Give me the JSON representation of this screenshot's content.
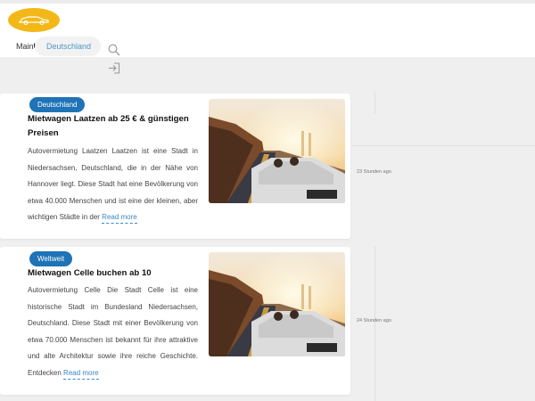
{
  "header": {
    "logo": {
      "name": "car-logo",
      "color": "#f3b818"
    },
    "nav": {
      "main_label": "Main",
      "pill_label": "Deutschland"
    },
    "icons": [
      "search-icon",
      "login-icon"
    ]
  },
  "articles": [
    {
      "badge": "Deutschland",
      "title": "Mietwagen Laatzen ab 25 € & günstigen Preisen",
      "excerpt": "Autovermietung Laatzen Laatzen ist eine Stadt in Niedersachsen, Deutschland, die in der Nähe von Hannover liegt. Diese Stadt hat eine Bevölkerung von etwa 40.000 Menschen und ist eine der kleinen, aber wichtigen Städte in der",
      "read_more": "Read more",
      "timestamp": "23 Stunden ago",
      "image_alt": "convertible-car-sunset-photo"
    },
    {
      "badge": "Weltweit",
      "title": "Mietwagen Celle buchen ab 10",
      "excerpt": "Autovermietung Celle Die Stadt Celle ist eine historische Stadt im Bundesland Niedersachsen, Deutschland. Diese Stadt mit einer Bevölkerung von etwa 70.000 Menschen ist bekannt für ihre attraktive und alte Architektur sowie ihre reiche Geschichte. Entdecken",
      "read_more": "Read more",
      "timestamp": "24 Stunden ago",
      "image_alt": "convertible-car-sunset-photo"
    }
  ],
  "colors": {
    "accent": "#1f73b7",
    "link": "#3a87c7",
    "logo": "#f3b818"
  }
}
